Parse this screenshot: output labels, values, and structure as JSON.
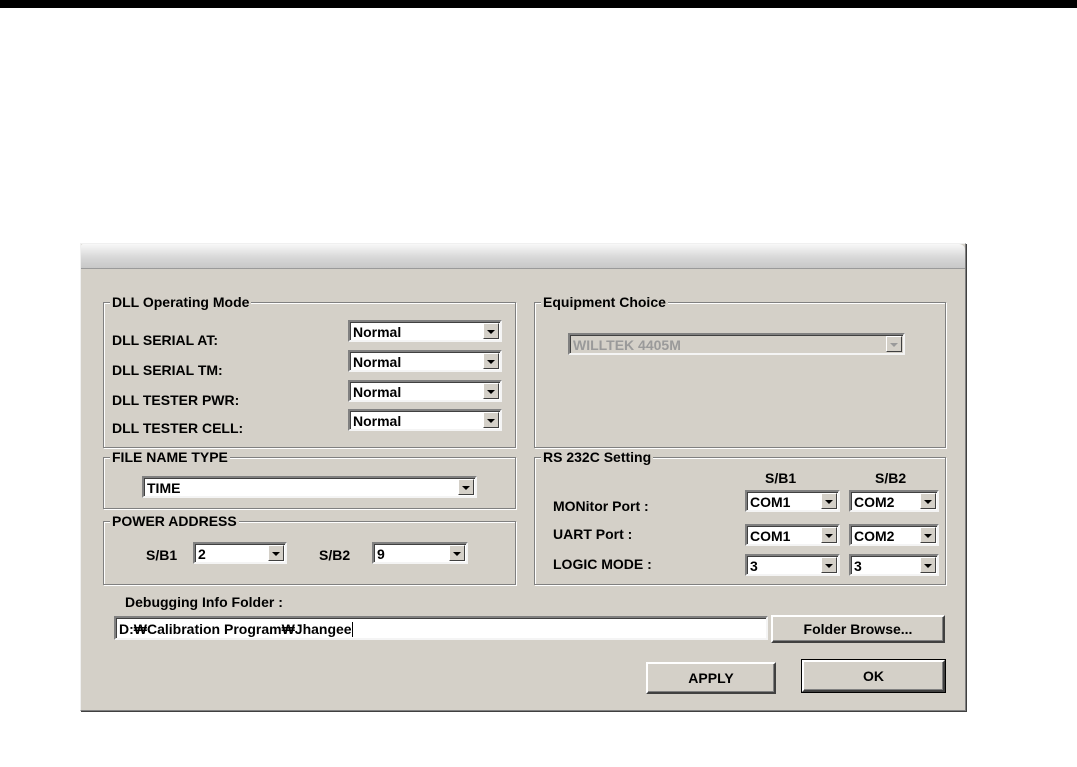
{
  "dll_mode": {
    "title": "DLL Operating Mode",
    "rows": [
      {
        "label": "DLL SERIAL AT:",
        "value": "Normal"
      },
      {
        "label": "DLL SERIAL TM:",
        "value": "Normal"
      },
      {
        "label": "DLL TESTER PWR:",
        "value": "Normal"
      },
      {
        "label": "DLL TESTER CELL:",
        "value": "Normal"
      }
    ]
  },
  "equipment": {
    "title": "Equipment Choice",
    "value": "WILLTEK 4405M"
  },
  "file_name_type": {
    "title": "FILE NAME TYPE",
    "value": "TIME"
  },
  "power_address": {
    "title": "POWER ADDRESS",
    "sb1_label": "S/B1",
    "sb1_value": "2",
    "sb2_label": "S/B2",
    "sb2_value": "9"
  },
  "rs232c": {
    "title": "RS 232C Setting",
    "col1": "S/B1",
    "col2": "S/B2",
    "rows": [
      {
        "label": "MONitor Port :",
        "sb1": "COM1",
        "sb2": "COM2"
      },
      {
        "label": "UART Port :",
        "sb1": "COM1",
        "sb2": "COM2"
      },
      {
        "label": "LOGIC MODE :",
        "sb1": "3",
        "sb2": "3"
      }
    ]
  },
  "debug": {
    "label": "Debugging Info Folder :",
    "path": "D:₩Calibration Program₩Jhangee",
    "browse_label": "Folder Browse..."
  },
  "buttons": {
    "apply": "APPLY",
    "ok": "OK"
  }
}
